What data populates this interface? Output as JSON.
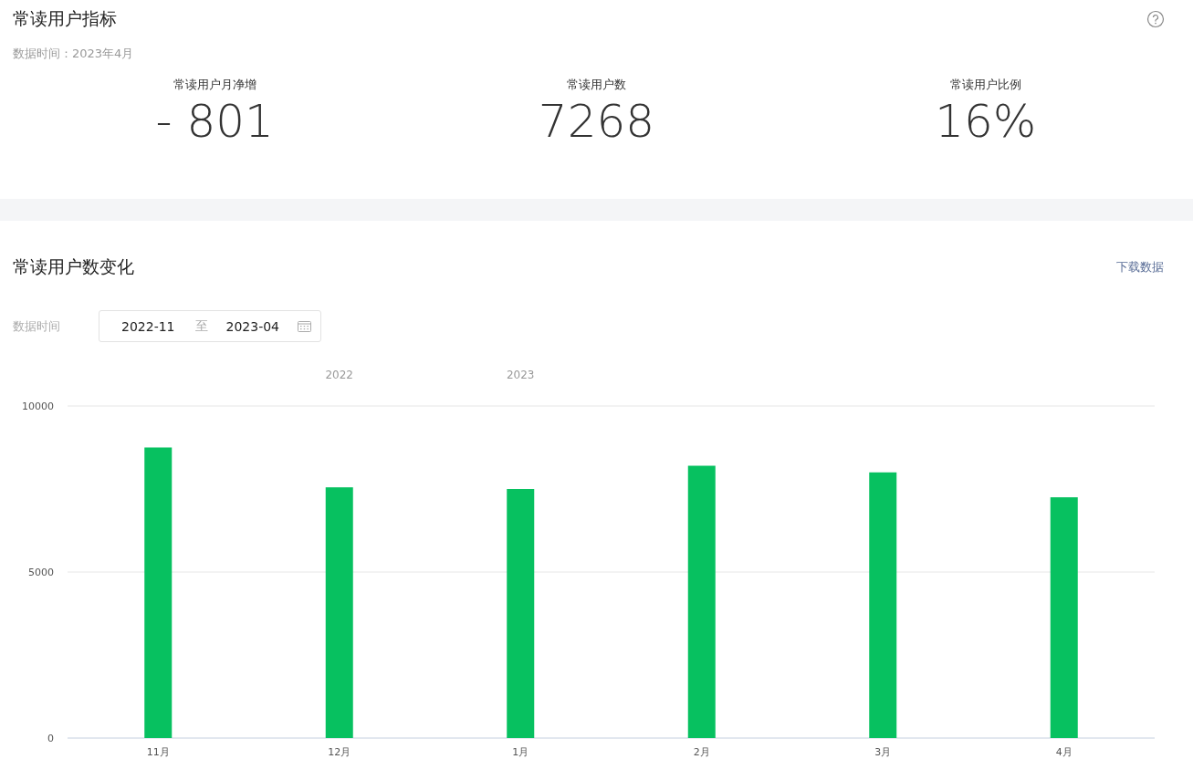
{
  "summary": {
    "title": "常读用户指标",
    "data_time": "数据时间：2023年4月",
    "metrics": [
      {
        "label": "常读用户月净增",
        "value": "- 801"
      },
      {
        "label": "常读用户数",
        "value": "7268"
      },
      {
        "label": "常读用户比例",
        "value": "16%"
      }
    ]
  },
  "trend": {
    "title": "常读用户数变化",
    "download": "下载数据",
    "date_label": "数据时间",
    "date_start": "2022-11",
    "date_sep": "至",
    "date_end": "2023-04",
    "chart_data": {
      "type": "bar",
      "categories": [
        "11月",
        "12月",
        "1月",
        "2月",
        "3月",
        "4月"
      ],
      "series": [
        {
          "color": "#07c160",
          "values": [
            8750,
            7550,
            7500,
            8200,
            8000,
            7250
          ]
        }
      ],
      "ylim": [
        0,
        10000
      ],
      "yticks": [
        0,
        5000,
        10000
      ],
      "annotations": [
        "2022",
        "2023"
      ]
    }
  }
}
